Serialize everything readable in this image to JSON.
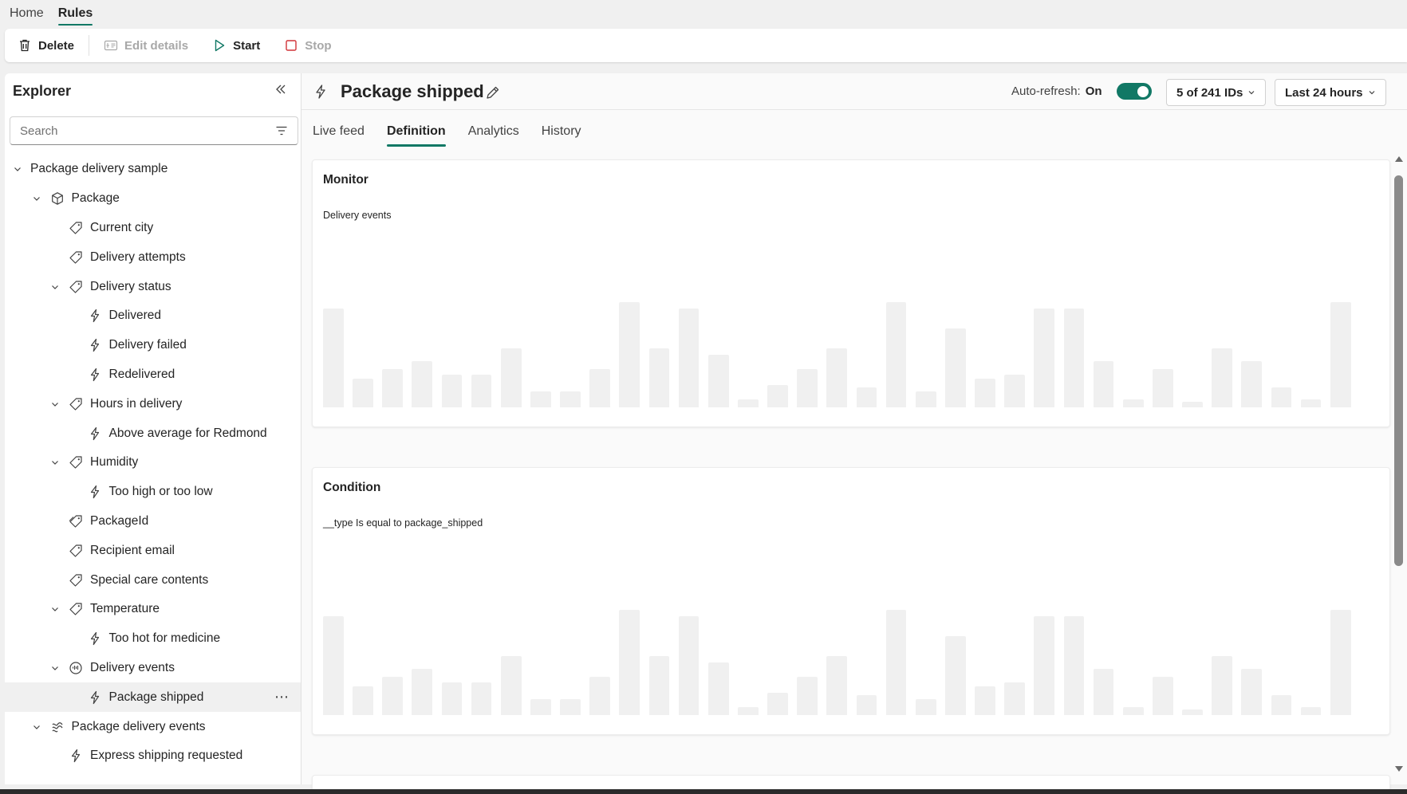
{
  "topnav": {
    "tabs": [
      {
        "label": "Home"
      },
      {
        "label": "Rules"
      }
    ],
    "active": "Rules"
  },
  "toolbar": {
    "delete_label": "Delete",
    "edit_label": "Edit details",
    "start_label": "Start",
    "stop_label": "Stop"
  },
  "explorer": {
    "title": "Explorer",
    "search_placeholder": "Search",
    "tree": [
      {
        "label": "Package delivery sample",
        "level": 0,
        "chevron": true,
        "icon": "none"
      },
      {
        "label": "Package",
        "level": 1,
        "chevron": true,
        "icon": "cube-icon"
      },
      {
        "label": "Current city",
        "level": 2,
        "chevron": false,
        "icon": "tag-icon"
      },
      {
        "label": "Delivery attempts",
        "level": 2,
        "chevron": false,
        "icon": "tag-icon"
      },
      {
        "label": "Delivery status",
        "level": 2,
        "chevron": true,
        "icon": "tag-icon"
      },
      {
        "label": "Delivered",
        "level": 3,
        "chevron": false,
        "icon": "flash-icon"
      },
      {
        "label": "Delivery failed",
        "level": 3,
        "chevron": false,
        "icon": "flash-icon"
      },
      {
        "label": "Redelivered",
        "level": 3,
        "chevron": false,
        "icon": "flash-icon"
      },
      {
        "label": "Hours in delivery",
        "level": 2,
        "chevron": true,
        "icon": "tag-icon"
      },
      {
        "label": "Above average for Redmond",
        "level": 3,
        "chevron": false,
        "icon": "flash-icon"
      },
      {
        "label": "Humidity",
        "level": 2,
        "chevron": true,
        "icon": "tag-icon"
      },
      {
        "label": "Too high or too low",
        "level": 3,
        "chevron": false,
        "icon": "flash-icon"
      },
      {
        "label": "PackageId",
        "level": 2,
        "chevron": false,
        "icon": "tag-double-icon"
      },
      {
        "label": "Recipient email",
        "level": 2,
        "chevron": false,
        "icon": "tag-icon"
      },
      {
        "label": "Special care contents",
        "level": 2,
        "chevron": false,
        "icon": "tag-icon"
      },
      {
        "label": "Temperature",
        "level": 2,
        "chevron": true,
        "icon": "tag-icon"
      },
      {
        "label": "Too hot for medicine",
        "level": 3,
        "chevron": false,
        "icon": "flash-icon"
      },
      {
        "label": "Delivery events",
        "level": 2,
        "chevron": true,
        "icon": "event-icon"
      },
      {
        "label": "Package shipped",
        "level": 3,
        "chevron": false,
        "icon": "flash-icon",
        "selected": true
      },
      {
        "label": "Package delivery events",
        "level": 1,
        "chevron": true,
        "icon": "stream-icon"
      },
      {
        "label": "Express shipping requested",
        "level": 2,
        "chevron": false,
        "icon": "flash-icon"
      }
    ]
  },
  "main": {
    "title": "Package shipped",
    "autorefresh_label": "Auto-refresh:",
    "autorefresh_state": "On",
    "ids_dropdown": "5 of 241 IDs",
    "time_dropdown": "Last 24 hours",
    "tabs": [
      {
        "label": "Live feed"
      },
      {
        "label": "Definition"
      },
      {
        "label": "Analytics"
      },
      {
        "label": "History"
      }
    ],
    "active_tab": "Definition",
    "cards": [
      {
        "title": "Monitor",
        "subtitle": "Delivery events"
      },
      {
        "title": "Condition",
        "subtitle": "__type Is equal to package_shipped"
      }
    ],
    "placeholder_bar_levels": [
      0.75,
      0.22,
      0.29,
      0.35,
      0.25,
      0.25,
      0.45,
      0.12,
      0.12,
      0.29,
      0.8,
      0.45,
      0.75,
      0.4,
      0.06,
      0.17,
      0.29,
      0.45,
      0.15,
      0.8,
      0.12,
      0.6,
      0.22,
      0.25,
      0.75,
      0.75,
      0.35,
      0.06,
      0.29,
      0.04,
      0.45,
      0.35,
      0.15,
      0.06,
      0.8
    ]
  },
  "colors": {
    "accent": "#117865",
    "placeholder_bar": "#f0f0f0",
    "stop_icon": "#d13438",
    "start_icon": "#117865"
  }
}
